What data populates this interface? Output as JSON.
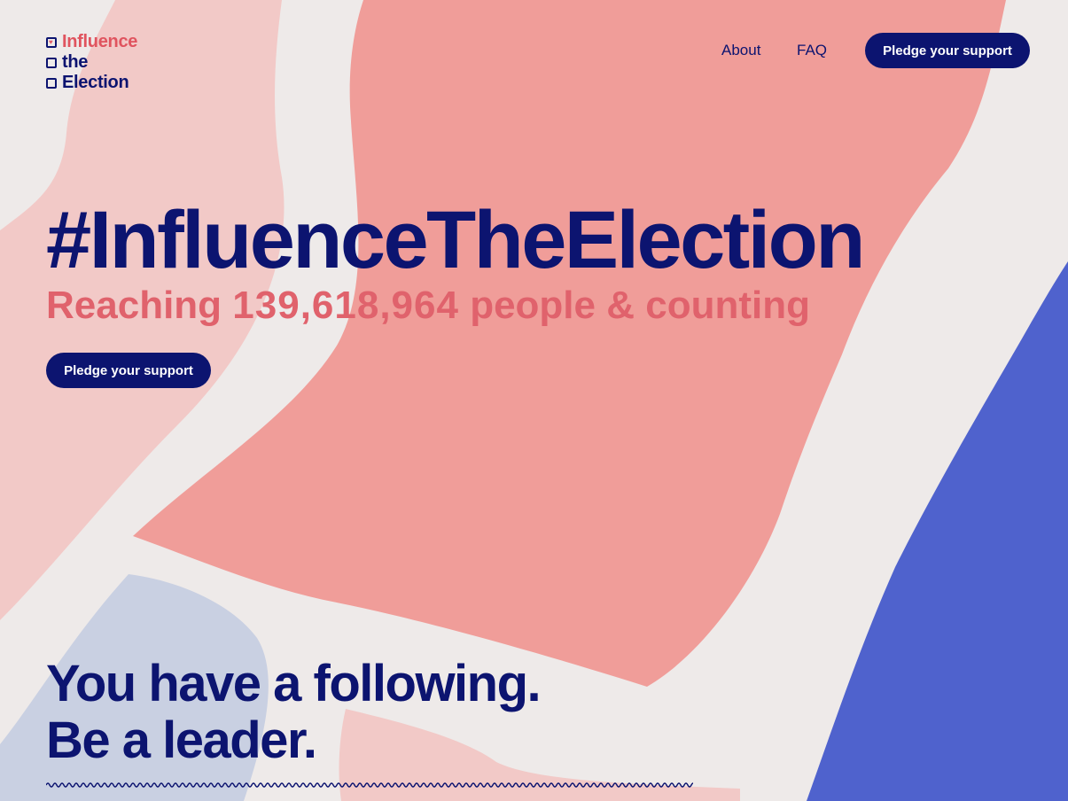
{
  "logo": {
    "line1": "Influence",
    "line2": "the",
    "line3": "Election"
  },
  "nav": {
    "about": "About",
    "faq": "FAQ",
    "cta": "Pledge your support"
  },
  "hero": {
    "headline": "#InfluenceTheElection",
    "reach_prefix": "Reaching",
    "reach_count": "139,618,964",
    "reach_suffix": "people & counting",
    "cta": "Pledge your support"
  },
  "section": {
    "line1": "You have a following.",
    "line2": "Be a leader."
  },
  "colors": {
    "navy": "#0c1470",
    "coral": "#e0626c",
    "salmon_shape": "#f09d99",
    "pale_pink_shape": "#f2c9c7",
    "blue_shape": "#4f62cd",
    "lavender_shape": "#c9d0e2",
    "background": "#eeeae9"
  },
  "icons": [
    "heart-checkbox-icon",
    "checkbox-icon",
    "checkbox-icon",
    "wave-divider"
  ]
}
